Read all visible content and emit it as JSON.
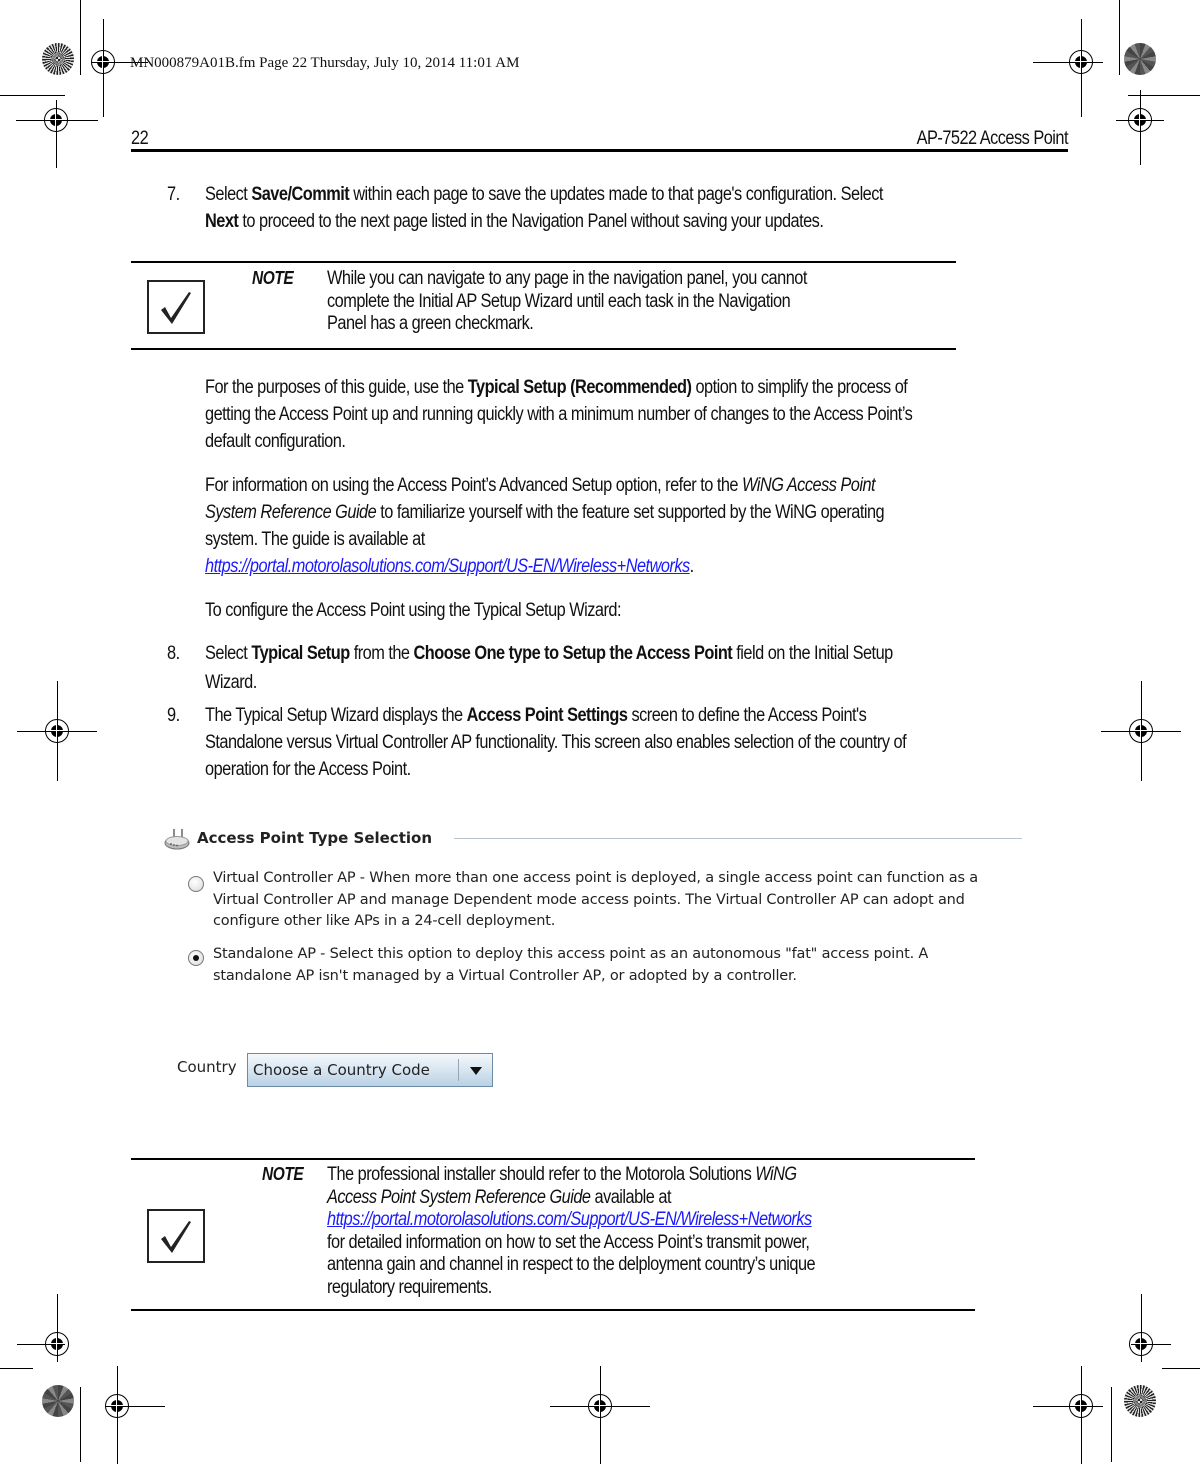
{
  "print_slug": "MN000879A01B.fm  Page 22  Thursday, July 10, 2014  11:01 AM",
  "header": {
    "page_number": "22",
    "title": "AP-7522 Access Point"
  },
  "steps": {
    "step7": {
      "number": "7.",
      "p1": "Select ",
      "b1": "Save/Commit",
      "p2": " within each page to save the updates made to that page's configuration. Select",
      "b2": "Next",
      "p3": " to proceed to the next page listed in the Navigation Panel without saving your updates."
    },
    "step8": {
      "number": "8.",
      "p1": "Select ",
      "b1": "Typical Setup",
      "p2": " from the ",
      "b2": "Choose One type to Setup the Access Point",
      "p3": " field on the Initial Setup",
      "line2": "Wizard."
    },
    "step9": {
      "number": "9.",
      "p1": "The Typical Setup Wizard displays the ",
      "b1": "Access Point Settings",
      "p2": " screen to define the Access Point's",
      "line2": "Standalone versus Virtual Controller AP functionality. This screen also enables selection of the country of",
      "line3": "operation for the Access Point."
    }
  },
  "note1": {
    "label": "NOTE",
    "lines": [
      "While you can navigate to any page in the navigation panel, you cannot",
      "complete the Initial AP Setup Wizard until each task in the Navigation",
      "Panel has a green checkmark."
    ]
  },
  "paragraphs": {
    "typical": {
      "p1": "For the purposes of this guide, use the ",
      "b1": "Typical Setup (Recommended)",
      "p2": " option to simplify the process of",
      "line2": "getting the Access Point up and running quickly with a minimum number of changes to the Access Point’s",
      "line3": "default configuration."
    },
    "advanced": {
      "p1": "For information on using the Access Point’s Advanced Setup option, refer to the ",
      "i1": "WiNG Access Point",
      "i2": "System Reference Guide",
      "p2": " to familiarize yourself with the feature set supported by the WiNG operating",
      "line3": "system. The guide is available at",
      "link": "https://portal.motorolasolutions.com/Support/US-EN/Wireless+Networks",
      "after_link": "."
    },
    "configure": "To configure the Access Point using the Typical Setup Wizard:"
  },
  "screenshot": {
    "section_title": "Access Point Type Selection",
    "options": [
      {
        "selected": false,
        "lines": [
          "Virtual Controller AP - When more than one access point is deployed, a single access point can function as a",
          "Virtual Controller AP and manage Dependent mode access points.  The Virtual Controller AP can adopt and",
          "configure other like APs in a 24-cell deployment."
        ]
      },
      {
        "selected": true,
        "lines": [
          "Standalone AP - Select this option to deploy this access point as an autonomous \"fat\" access point. A",
          "standalone AP isn't managed by a Virtual Controller AP, or adopted by a controller."
        ]
      }
    ],
    "country_label": "Country",
    "country_value": "Choose a Country Code"
  },
  "note2": {
    "label": "NOTE",
    "p1": "The professional installer should refer to the Motorola Solutions ",
    "i1": "WiNG",
    "i2": "Access Point System Reference Guide",
    "p2": " available at",
    "link": "https://portal.motorolasolutions.com/Support/US-EN/Wireless+Networks",
    "line4": "for detailed information on how to set the Access Point’s transmit power,",
    "line5": "antenna gain and channel in respect to the delployment country’s unique",
    "line6": "regulatory requirements."
  }
}
